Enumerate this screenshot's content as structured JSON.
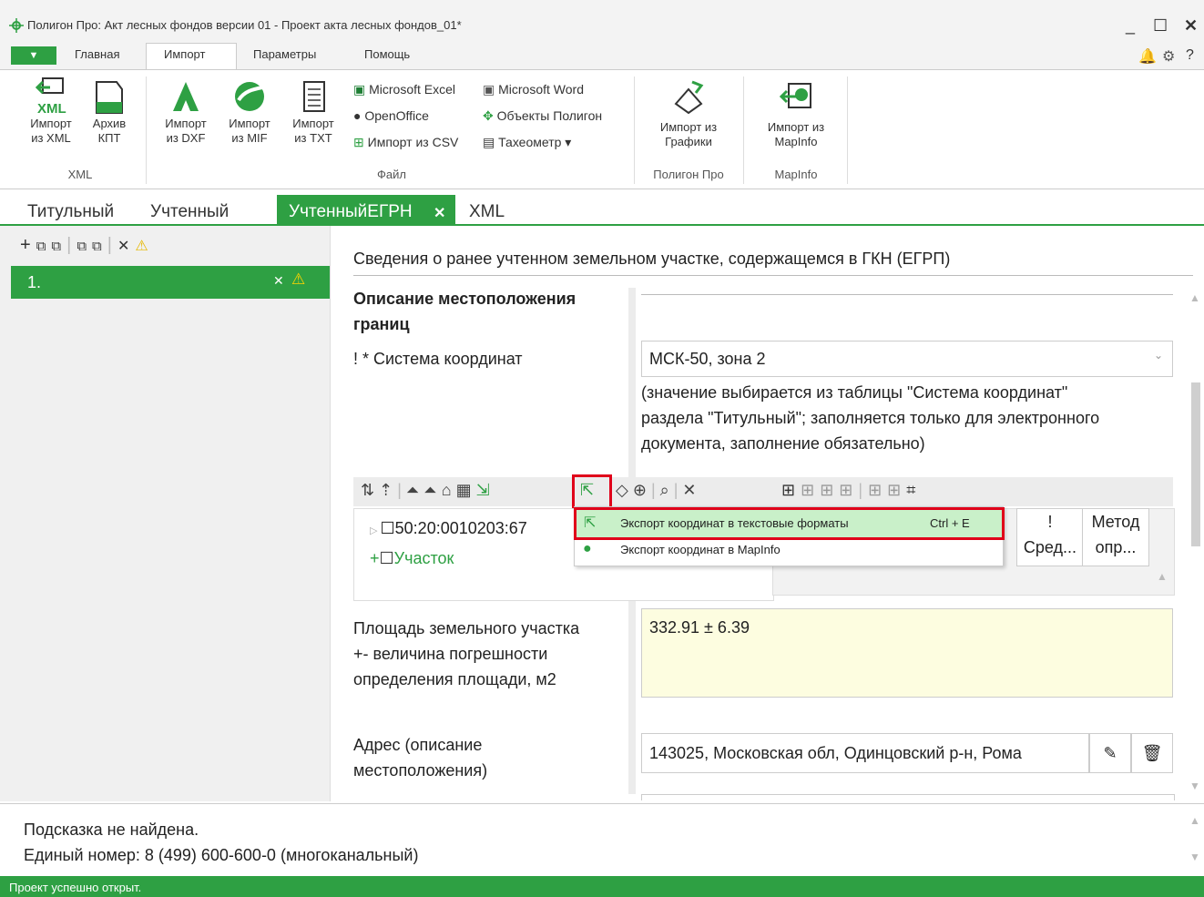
{
  "window": {
    "title": "Полигон Про: Акт лесных фондов версии 01 - Проект акта лесных фондов_01*",
    "minimize": "_",
    "maximize": "☐",
    "close": "✕",
    "help": "?"
  },
  "ribbon_tabs": [
    "Главная",
    "Импорт",
    "Параметры",
    "Помощь"
  ],
  "ribbon": {
    "xml_group": {
      "label": "XML",
      "btn_xml_line1": "Импорт",
      "btn_xml_line2": "из XML",
      "btn_kpt_line1": "Архив",
      "btn_kpt_line2": "КПТ",
      "xml_glyph": "XML"
    },
    "file_group": {
      "label": "Файл",
      "btn_dxf_line1": "Импорт",
      "btn_dxf_line2": "из DXF",
      "btn_mif_line1": "Импорт",
      "btn_mif_line2": "из MIF",
      "btn_txt_line1": "Импорт",
      "btn_txt_line2": "из TXT",
      "excel": "Microsoft Excel",
      "word": "Microsoft Word",
      "openoffice": "OpenOffice",
      "polygon_objects": "Объекты Полигон",
      "csv": "Импорт из CSV",
      "tacheometer": "Тахеометр ▾"
    },
    "polygon_group": {
      "label": "Полигон Про",
      "btn_line1": "Импорт из",
      "btn_line2": "Графики"
    },
    "mapinfo_group": {
      "label": "MapInfo",
      "btn_line1": "Импорт из",
      "btn_line2": "MapInfo"
    }
  },
  "doc_tabs": {
    "t1": "Титульный",
    "t2": "Учтенный",
    "t3": "УчтенныйЕГРН",
    "t3_close": "✕",
    "t4": "XML"
  },
  "left": {
    "row_label": "1."
  },
  "content": {
    "section_title": "Сведения о ранее учтенном земельном участке, содержащемся в ГКН (ЕГРП)",
    "boundary_heading_line1": "Описание местоположения",
    "boundary_heading_line2": "границ",
    "coord_system_label": "! * Система координат",
    "coord_system_value": "МСК-50, зона 2",
    "coord_hint_line1": "(значение выбирается из таблицы \"Система координат\"",
    "coord_hint_line2": "раздела \"Титульный\"; заполняется только для электронного",
    "coord_hint_line3": "документа, заполнение обязательно)",
    "tree_item": "50:20:0010203:67",
    "tree_add": "Участок",
    "col_mark": "!",
    "col_mark2": "Сред...",
    "col_method": "Метод",
    "col_method2": "опр...",
    "area_label_line1": "Площадь земельного участка",
    "area_label_line2": "+- величина погрешности",
    "area_label_line3": "определения площади, м2",
    "area_value": "332.91 ± 6.39",
    "address_label_line1": "Адрес (описание",
    "address_label_line2": "местоположения)",
    "address_value": "143025, Московская обл, Одинцовский р-н, Рома"
  },
  "dropdown": {
    "item1": "Экспорт координат в текстовые форматы",
    "item1_shortcut": "Ctrl + E",
    "item2": "Экспорт координат в MapInfo"
  },
  "hint": {
    "line1": "Подсказка не найдена.",
    "line2": "Единый номер: 8 (499) 600-600-0 (многоканальный)"
  },
  "status": "Проект успешно открыт.",
  "colors": {
    "accent": "#2ea043",
    "highlight": "#e0001a",
    "field_yellow": "#fdfde0"
  }
}
